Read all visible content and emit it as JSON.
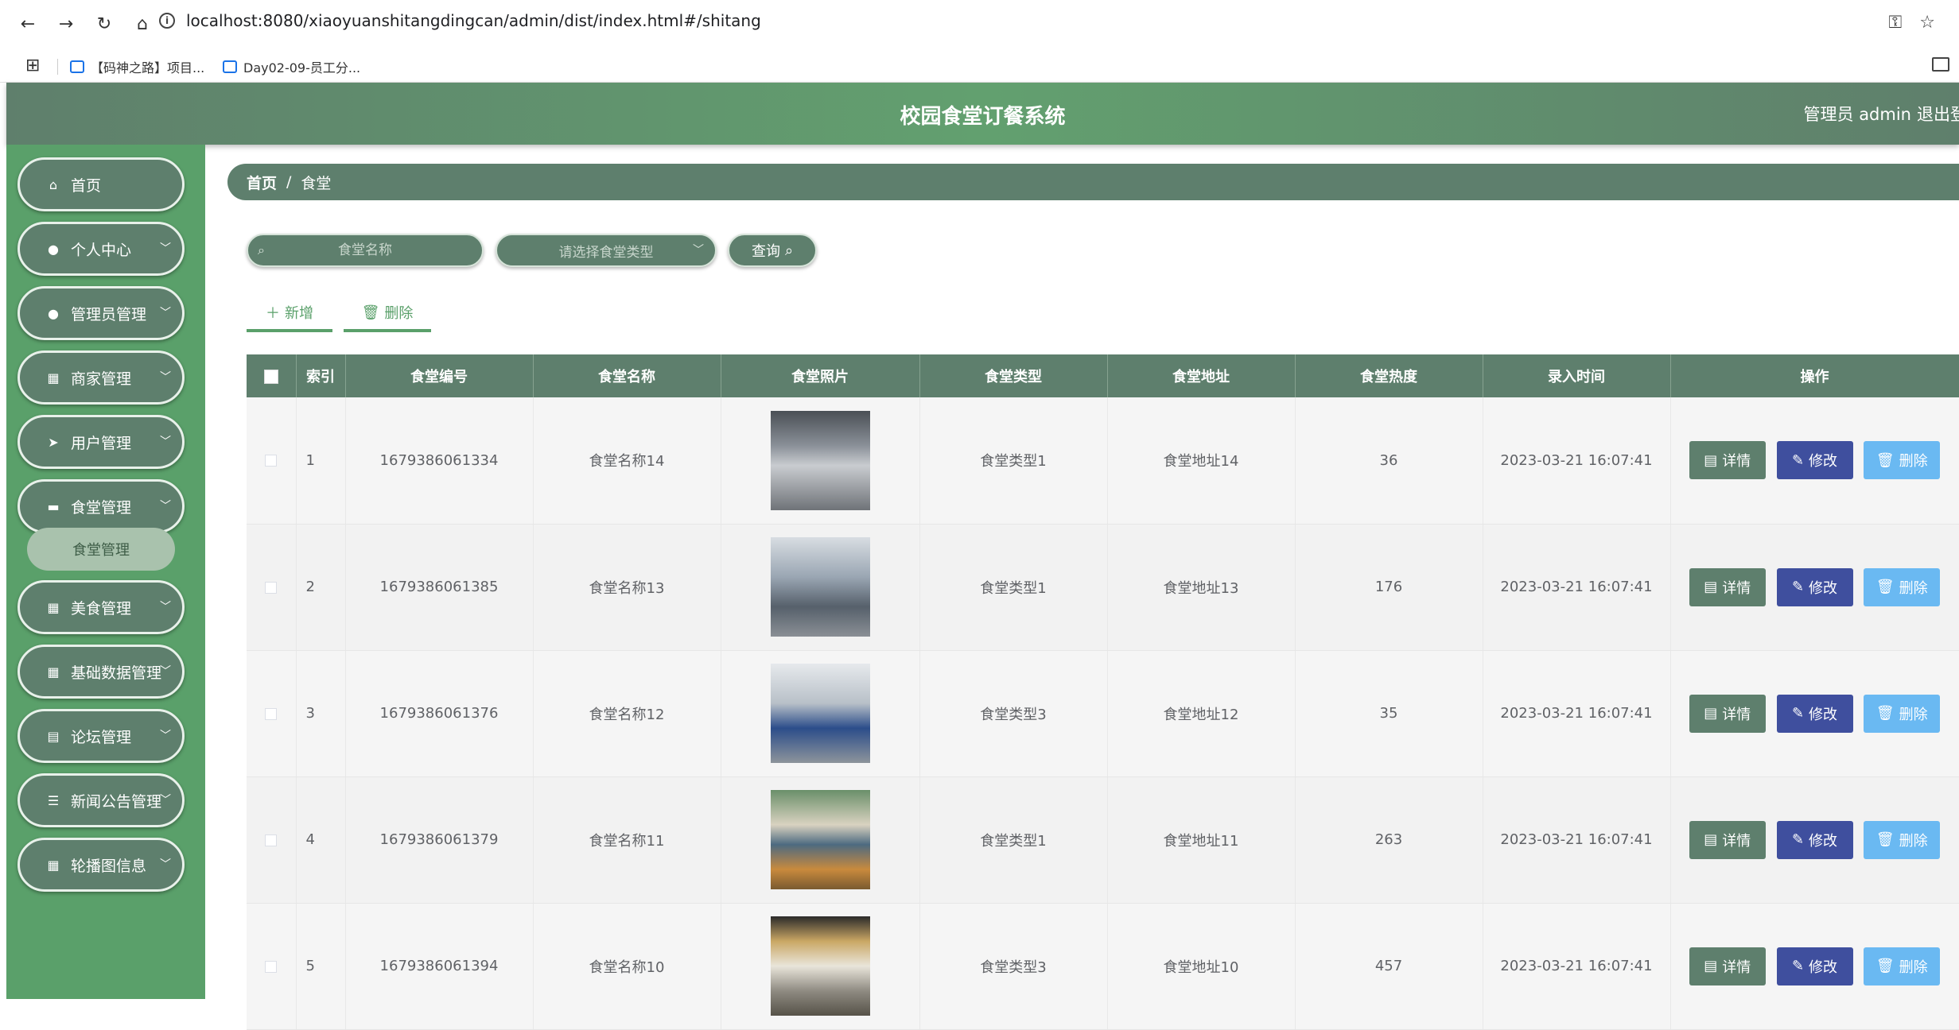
{
  "browser": {
    "url": "localhost:8080/xiaoyuanshitangdingcan/admin/dist/index.html#/shitang",
    "bookmarks": [
      "【码神之路】项目...",
      "Day02-09-员工分..."
    ]
  },
  "header": {
    "title": "校园食堂订餐系统",
    "user": "管理员 admin",
    "logout": "退出登"
  },
  "sidebar": {
    "items": [
      {
        "label": "首页",
        "icon": "home-icon",
        "glyph": "⌂"
      },
      {
        "label": "个人中心",
        "icon": "user-icon",
        "glyph": "●"
      },
      {
        "label": "管理员管理",
        "icon": "pin-icon",
        "glyph": "●"
      },
      {
        "label": "商家管理",
        "icon": "grid-icon",
        "glyph": "▦"
      },
      {
        "label": "用户管理",
        "icon": "send-icon",
        "glyph": "➤"
      },
      {
        "label": "食堂管理",
        "icon": "briefcase-icon",
        "glyph": "▬"
      },
      {
        "label": "美食管理",
        "icon": "grid-icon",
        "glyph": "▦"
      },
      {
        "label": "基础数据管理",
        "icon": "grid-icon",
        "glyph": "▦"
      },
      {
        "label": "论坛管理",
        "icon": "clipboard-icon",
        "glyph": "▤"
      },
      {
        "label": "新闻公告管理",
        "icon": "sliders-icon",
        "glyph": "☰"
      },
      {
        "label": "轮播图信息",
        "icon": "grid-icon",
        "glyph": "▦"
      }
    ],
    "sub_item": "食堂管理"
  },
  "breadcrumb": {
    "home": "首页",
    "sep": "/",
    "current": "食堂"
  },
  "search": {
    "name_placeholder": "食堂名称",
    "type_placeholder": "请选择食堂类型",
    "query_label": "查询"
  },
  "actions": {
    "add_label": "新增",
    "delete_label": "删除"
  },
  "table": {
    "headers": [
      "",
      "索引",
      "食堂编号",
      "食堂名称",
      "食堂照片",
      "食堂类型",
      "食堂地址",
      "食堂热度",
      "录入时间",
      "操作"
    ],
    "rows": [
      {
        "index": "1",
        "code": "1679386061334",
        "name": "食堂名称14",
        "type": "食堂类型1",
        "address": "食堂地址14",
        "heat": "36",
        "time": "2023-03-21 16:07:41"
      },
      {
        "index": "2",
        "code": "1679386061385",
        "name": "食堂名称13",
        "type": "食堂类型1",
        "address": "食堂地址13",
        "heat": "176",
        "time": "2023-03-21 16:07:41"
      },
      {
        "index": "3",
        "code": "1679386061376",
        "name": "食堂名称12",
        "type": "食堂类型3",
        "address": "食堂地址12",
        "heat": "35",
        "time": "2023-03-21 16:07:41"
      },
      {
        "index": "4",
        "code": "1679386061379",
        "name": "食堂名称11",
        "type": "食堂类型1",
        "address": "食堂地址11",
        "heat": "263",
        "time": "2023-03-21 16:07:41"
      },
      {
        "index": "5",
        "code": "1679386061394",
        "name": "食堂名称10",
        "type": "食堂类型3",
        "address": "食堂地址10",
        "heat": "457",
        "time": "2023-03-21 16:07:41"
      }
    ],
    "op_labels": {
      "detail": "详情",
      "edit": "修改",
      "delete": "删除"
    }
  },
  "colors": {
    "primary": "#5e7f6d",
    "sidebar": "#5aa06a",
    "edit": "#3f4f9e",
    "delete": "#6ab9f2"
  }
}
